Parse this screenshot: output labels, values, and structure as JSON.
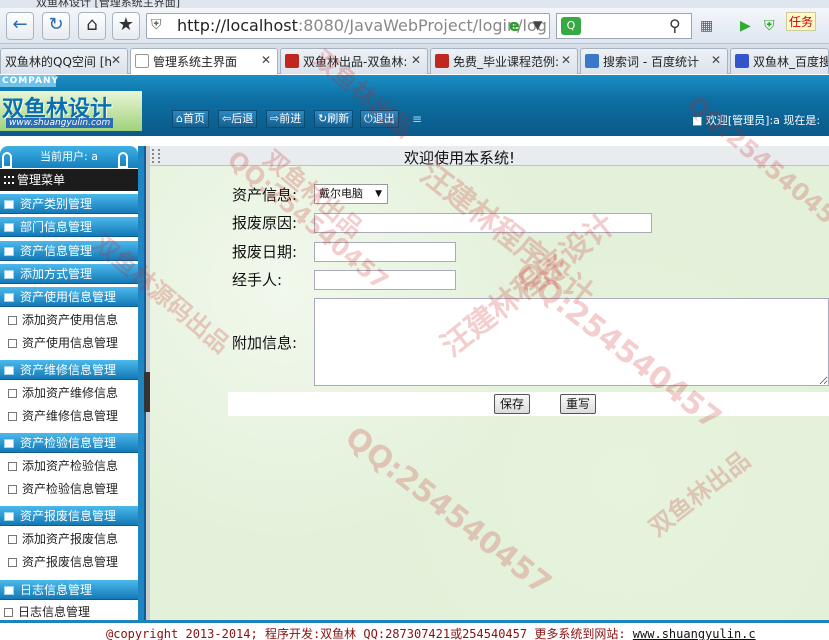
{
  "browser": {
    "window_title": "双鱼林设计 [管理系统主界面]",
    "url_host": "http://localhost",
    "url_rest": ":8080/JavaWebProject/login/log",
    "search_placeholder": "",
    "user_badge": "任务",
    "tabs": [
      {
        "label": "双鱼林的QQ空间 [h",
        "fav_color": "#f3c23a"
      },
      {
        "label": "管理系统主界面",
        "fav_color": "#ffffff"
      },
      {
        "label": "双鱼林出品-双鱼林:",
        "fav_color": "#c0281f"
      },
      {
        "label": "免费_毕业课程范例:",
        "fav_color": "#c0281f"
      },
      {
        "label": "搜索词 - 百度统计",
        "fav_color": "#3a78c8"
      },
      {
        "label": "双鱼林_百度搜",
        "fav_color": "#3355cc"
      }
    ]
  },
  "header": {
    "company_tag": "COMPANY",
    "logo_text": "双鱼林设计",
    "logo_url": "www.shuangyulin.com",
    "nav": [
      {
        "label": "首页",
        "icon": "home-icon"
      },
      {
        "label": "后退",
        "icon": "arrow-left-icon"
      },
      {
        "label": "前进",
        "icon": "arrow-right-icon"
      },
      {
        "label": "刷新",
        "icon": "refresh-icon"
      },
      {
        "label": "退出",
        "icon": "power-icon"
      }
    ],
    "welcome": "欢迎[管理员]:a 现在是:"
  },
  "sidebar": {
    "current_user": "当前用户: a",
    "menu_title": "管理菜单",
    "groups": [
      {
        "label": "资产类别管理",
        "items": []
      },
      {
        "label": "部门信息管理",
        "items": []
      },
      {
        "label": "资产信息管理",
        "items": []
      },
      {
        "label": "添加方式管理",
        "items": []
      },
      {
        "label": "资产使用信息管理",
        "items": [
          "添加资产使用信息",
          "资产使用信息管理"
        ]
      },
      {
        "label": "资产维修信息管理",
        "items": [
          "添加资产维修信息",
          "资产维修信息管理"
        ]
      },
      {
        "label": "资产检验信息管理",
        "items": [
          "添加资产检验信息",
          "资产检验信息管理"
        ]
      },
      {
        "label": "资产报废信息管理",
        "items": [
          "添加资产报废信息",
          "资产报废信息管理"
        ]
      },
      {
        "label": "日志信息管理",
        "items": [
          "日志信息管理"
        ]
      }
    ]
  },
  "main": {
    "title": "欢迎使用本系统!",
    "form": {
      "asset_label": "资产信息:",
      "asset_value": "戴尔电脑",
      "reason_label": "报废原因:",
      "reason_value": "",
      "date_label": "报废日期:",
      "date_value": "",
      "handler_label": "经手人:",
      "handler_value": "",
      "extra_label": "附加信息:",
      "save_label": "保存",
      "reset_label": "重写"
    }
  },
  "footer": {
    "text": "@copyright 2013-2014; 程序开发:双鱼林  QQ:287307421或254540457  更多系统到网站: ",
    "link": "www.shuangyulin.c"
  },
  "watermarks": [
    "汪建林程序设计",
    "QQ:254540457",
    "双鱼林出品",
    "双鱼林源码出品"
  ]
}
